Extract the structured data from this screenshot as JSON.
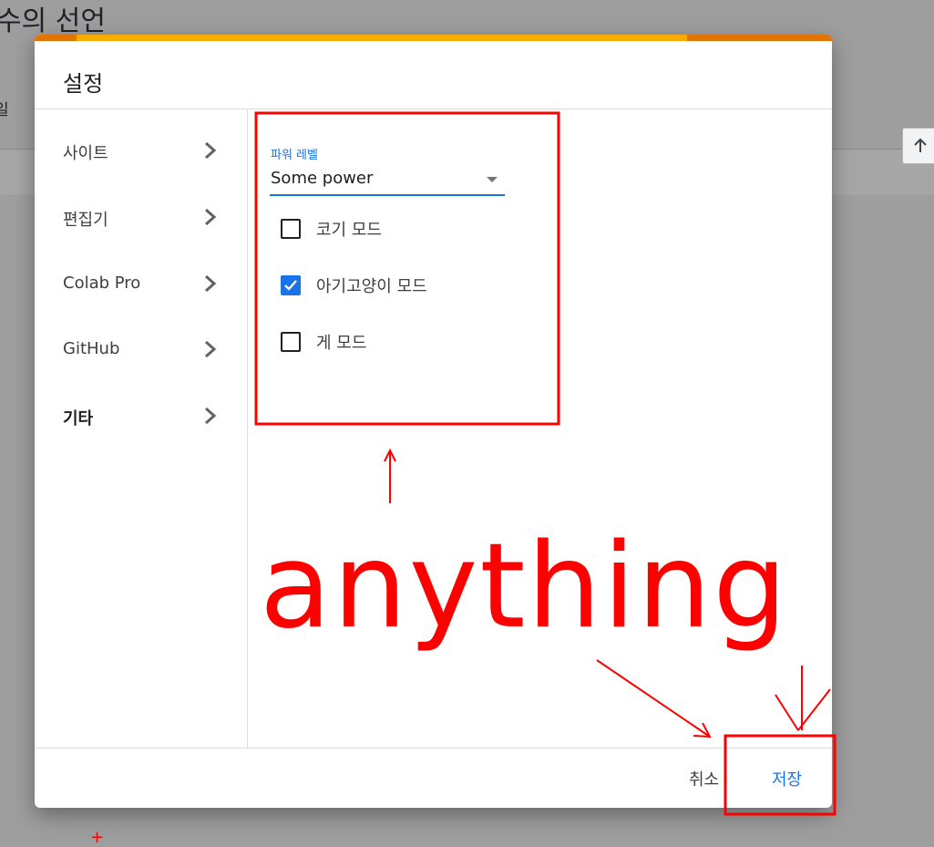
{
  "background": {
    "title_fragment": "수의 선언",
    "side_fragment": "일",
    "scroll_up_icon": "arrow-up-icon"
  },
  "dialog": {
    "title": "설정",
    "nav": [
      {
        "label": "사이트",
        "active": false
      },
      {
        "label": "편집기",
        "active": false
      },
      {
        "label": "Colab Pro",
        "active": false
      },
      {
        "label": "GitHub",
        "active": false
      },
      {
        "label": "기타",
        "active": true
      }
    ],
    "power_level": {
      "label": "파워 레벨",
      "value": "Some power"
    },
    "checkboxes": [
      {
        "label": "코기 모드",
        "checked": false
      },
      {
        "label": "아기고양이 모드",
        "checked": true
      },
      {
        "label": "게 모드",
        "checked": false
      }
    ],
    "buttons": {
      "cancel": "취소",
      "save": "저장"
    }
  },
  "annotations": {
    "text": "anything",
    "plus": "+"
  },
  "colors": {
    "accent": "#1a73e8",
    "annotation": "#ff0000",
    "progress_orange": "#e37400",
    "progress_yellow": "#f9ab00",
    "overlay": "#9e9e9e"
  }
}
